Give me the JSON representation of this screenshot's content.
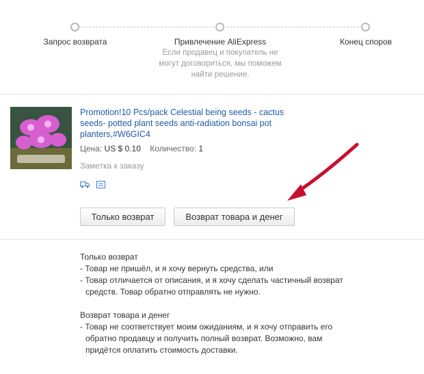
{
  "steps": [
    {
      "label": "Запрос возврата"
    },
    {
      "label": "Привлечение AliExpress",
      "description": "Если продавец и покупатель не могут договориться, мы поможем найти решение."
    },
    {
      "label": "Конец споров"
    }
  ],
  "product": {
    "title": "Promotion!10 Pcs/pack Celestial being seeds - cactus seeds- potted plant seeds anti-radiation bonsai pot planters,#W6GIC4",
    "price_label": "Цена:",
    "price_value": "US $ 0.10",
    "qty_label": "Количество:",
    "qty_value": "1",
    "note": "Заметка к заказу",
    "icons": [
      "delivery-truck-icon",
      "receipt-icon"
    ]
  },
  "buttons": {
    "only_refund": "Только возврат",
    "return_and_refund": "Возврат товара и денег"
  },
  "annotation": {
    "arrow_color": "#c8102e"
  },
  "explanations": {
    "only_refund": {
      "title": "Только возврат",
      "lines": [
        "- Товар не пришёл, и я хочу вернуть средства, или",
        "- Товар отличается от описания, и я хочу сделать частичный возврат",
        "средств. Товар обратно отправлять не нужно."
      ]
    },
    "return_and_refund": {
      "title": "Возврат товара и денег",
      "lines": [
        "- Товар не соответствует моим ожиданиям, и я хочу отправить его",
        "обратно продавцу и получить полный возврат. Возможно, вам",
        "придётся оплатить стоимость доставки."
      ]
    }
  }
}
